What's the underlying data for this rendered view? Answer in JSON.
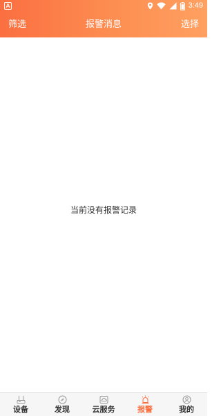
{
  "status_bar": {
    "time": "3:49"
  },
  "header": {
    "filter_label": "筛选",
    "title": "报警消息",
    "select_label": "选择"
  },
  "content": {
    "empty_text": "当前没有报警记录"
  },
  "tabs": [
    {
      "label": "设备",
      "icon": "device-icon",
      "active": false
    },
    {
      "label": "发现",
      "icon": "discover-icon",
      "active": false
    },
    {
      "label": "云服务",
      "icon": "cloud-service-icon",
      "active": false
    },
    {
      "label": "报警",
      "icon": "alarm-icon",
      "active": true
    },
    {
      "label": "我的",
      "icon": "profile-icon",
      "active": false
    }
  ],
  "colors": {
    "accent": "#fb6f40",
    "accent_end": "#ffa060",
    "tabbar_bg": "#f6f6f6",
    "tab_inactive": "#999999"
  }
}
